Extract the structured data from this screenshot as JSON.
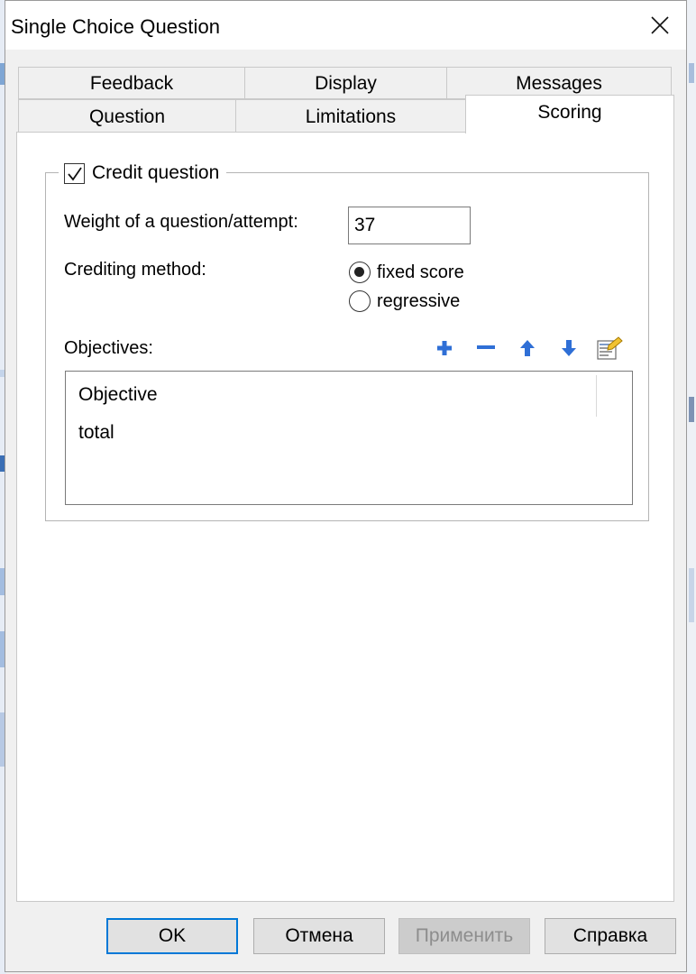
{
  "window": {
    "title": "Single Choice Question"
  },
  "tabs": {
    "row_back": [
      {
        "label": "Feedback"
      },
      {
        "label": "Display"
      },
      {
        "label": "Messages"
      }
    ],
    "row_front": [
      {
        "label": "Question"
      },
      {
        "label": "Limitations"
      },
      {
        "label": "Scoring",
        "active": true
      }
    ]
  },
  "scoring": {
    "credit_question": {
      "label": "Credit question",
      "checked": true
    },
    "weight": {
      "label": "Weight of a question/attempt:",
      "value": "37"
    },
    "crediting_method": {
      "label": "Crediting method:",
      "options": [
        {
          "label": "fixed score",
          "selected": true
        },
        {
          "label": "regressive",
          "selected": false
        }
      ]
    },
    "objectives": {
      "label": "Objectives:",
      "toolbar": [
        "add-icon",
        "remove-icon",
        "move-up-icon",
        "move-down-icon",
        "properties-icon"
      ],
      "column_header": "Objective",
      "rows": [
        "total"
      ]
    }
  },
  "buttons": {
    "ok": "OK",
    "cancel": "Отмена",
    "apply": "Применить",
    "help": "Справка"
  },
  "colors": {
    "accent": "#0078d7",
    "toolbar_icon": "#2f6fd6"
  }
}
